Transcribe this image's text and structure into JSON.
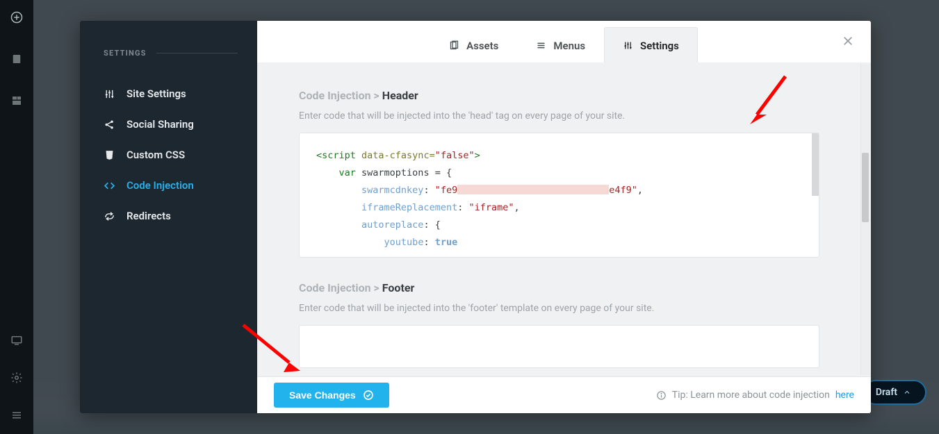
{
  "sidebar": {
    "heading": "SETTINGS",
    "items": [
      {
        "label": "Site Settings"
      },
      {
        "label": "Social Sharing"
      },
      {
        "label": "Custom CSS"
      },
      {
        "label": "Code Injection"
      },
      {
        "label": "Redirects"
      }
    ],
    "active_index": 3
  },
  "tabs": {
    "items": [
      {
        "label": "Assets"
      },
      {
        "label": "Menus"
      },
      {
        "label": "Settings"
      }
    ],
    "active_index": 2
  },
  "header_section": {
    "breadcrumb_prefix": "Code Injection > ",
    "breadcrumb_target": "Header",
    "description": "Enter code that will be injected into the 'head' tag on every page of your site.",
    "code": {
      "line1_open": "<script",
      "line1_attr": " data-cfasync=",
      "line1_val": "\"false\"",
      "line1_close": ">",
      "line2_kw": "var",
      "line2_var": " swarmoptions = {",
      "line3_key": "swarmcdnkey",
      "line3_val_pre": "\"fe9",
      "line3_val_post": "e4f9\"",
      "line4_key": "iframeReplacement",
      "line4_val": "\"iframe\"",
      "line5_key": "autoreplace",
      "line5_val": ": {",
      "line6_key": "youtube",
      "line6_val": "true"
    }
  },
  "footer_section": {
    "breadcrumb_prefix": "Code Injection > ",
    "breadcrumb_target": "Footer",
    "description": "Enter code that will be injected into the 'footer' template on every page of your site."
  },
  "bottom": {
    "save_label": "Save Changes",
    "tip_prefix": "Tip: Learn more about code injection ",
    "tip_link": "here"
  },
  "draft_button": {
    "label": "Draft"
  }
}
